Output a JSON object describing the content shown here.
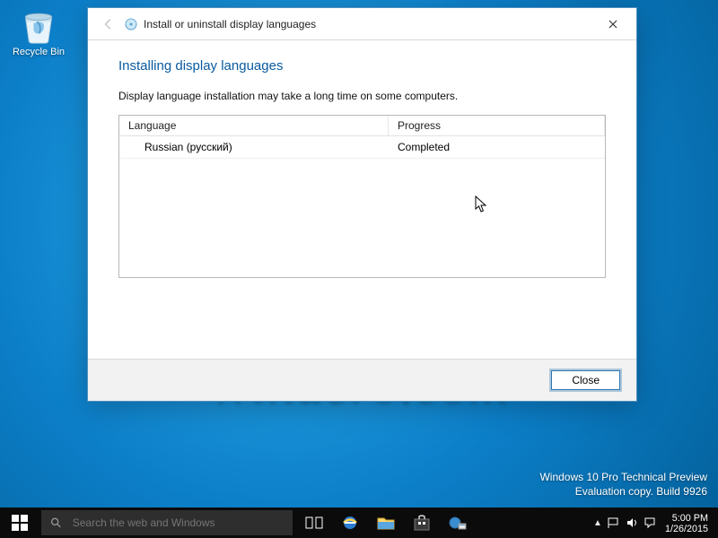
{
  "desktop": {
    "recycle_label": "Recycle Bin",
    "watermark": "Winaero.com",
    "info_line1": "Windows 10 Pro Technical Preview",
    "info_line2": "Evaluation copy. Build 9926"
  },
  "dialog": {
    "title": "Install or uninstall display languages",
    "heading": "Installing display languages",
    "note": "Display language installation may take a long time on some computers.",
    "columns": {
      "language": "Language",
      "progress": "Progress"
    },
    "rows": [
      {
        "language": "Russian (русский)",
        "progress": "Completed"
      }
    ],
    "close_label": "Close"
  },
  "taskbar": {
    "search_placeholder": "Search the web and Windows",
    "time": "5:00 PM",
    "date": "1/26/2015"
  }
}
